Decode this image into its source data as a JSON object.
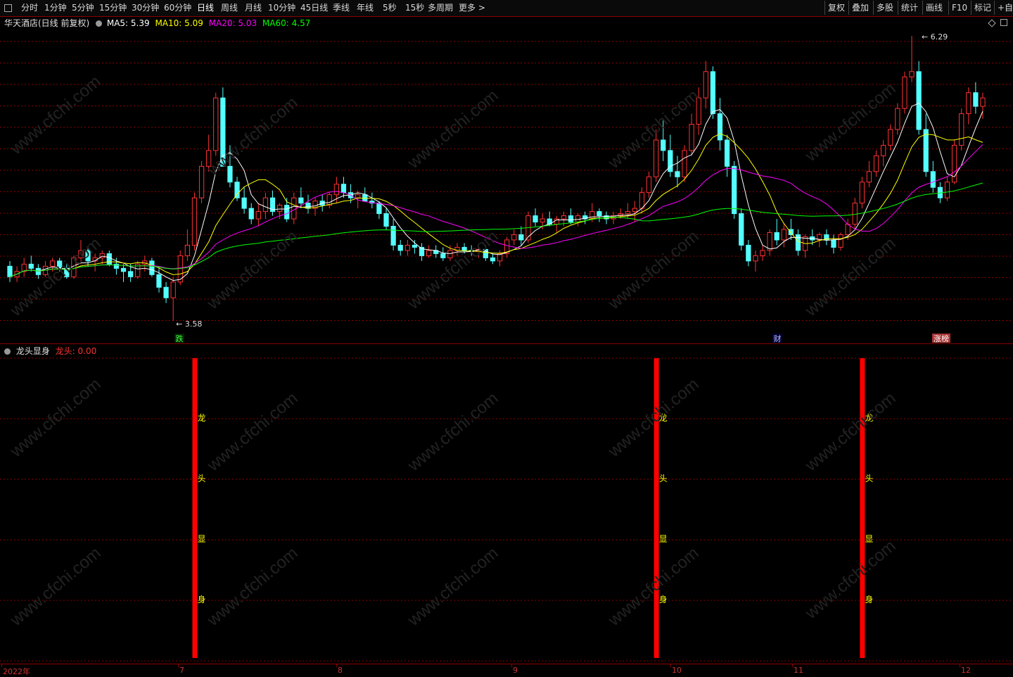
{
  "toolbar": {
    "periods": [
      "分时",
      "1分钟",
      "5分钟",
      "15分钟",
      "30分钟",
      "60分钟",
      "日线",
      "周线",
      "月线",
      "10分钟",
      "45日线",
      "季线",
      "年线",
      "5秒",
      "15秒",
      "多周期",
      "更多 >"
    ],
    "active": "日线",
    "right_buttons": [
      "复权",
      "叠加",
      "多股",
      "统计",
      "画线",
      "F10",
      "标记",
      "+自"
    ]
  },
  "main": {
    "title": "华天酒店(日线 前复权)",
    "ma5_label": "MA5: 5.39",
    "ma10_label": "MA10: 5.09",
    "ma20_label": "MA20: 5.03",
    "ma60_label": "MA60: 4.57",
    "max_label": "6.29",
    "min_label": "3.58",
    "event_markers": [
      "跌",
      "财",
      "涨榜"
    ]
  },
  "sub": {
    "title": "龙头显身",
    "value_label": "龙头: 0.00",
    "bar_chars": [
      "龙",
      "头",
      "显",
      "身"
    ]
  },
  "xaxis": {
    "labels": [
      "2022年",
      "7",
      "8",
      "9",
      "10",
      "11",
      "12"
    ]
  },
  "watermark": "www.cfchi.com",
  "colors": {
    "up": "#ff3232",
    "down": "#54ffff",
    "ma5": "#ffffff",
    "ma10": "#ffff00",
    "ma20": "#ff00ff",
    "ma60": "#00ff00",
    "grid": "#8b0000",
    "signal": "#ff0000"
  },
  "chart_data": {
    "type": "candlestick",
    "ylim": [
      3.5,
      6.35
    ],
    "max_price": 6.29,
    "min_price": 3.58,
    "candles": [
      [
        4.1,
        4.15,
        3.95,
        4.0
      ],
      [
        4.0,
        4.1,
        3.95,
        4.05
      ],
      [
        4.05,
        4.18,
        4.0,
        4.12
      ],
      [
        4.12,
        4.2,
        4.05,
        4.08
      ],
      [
        4.08,
        4.12,
        3.98,
        4.02
      ],
      [
        4.02,
        4.15,
        4.0,
        4.1
      ],
      [
        4.1,
        4.18,
        4.05,
        4.15
      ],
      [
        4.15,
        4.18,
        4.05,
        4.08
      ],
      [
        4.08,
        4.12,
        3.98,
        4.0
      ],
      [
        4.0,
        4.2,
        3.98,
        4.18
      ],
      [
        4.18,
        4.35,
        4.12,
        4.25
      ],
      [
        4.25,
        4.28,
        4.1,
        4.15
      ],
      [
        4.15,
        4.22,
        4.05,
        4.18
      ],
      [
        4.18,
        4.25,
        4.12,
        4.22
      ],
      [
        4.22,
        4.25,
        4.1,
        4.12
      ],
      [
        4.12,
        4.18,
        4.02,
        4.08
      ],
      [
        4.08,
        4.12,
        3.95,
        4.05
      ],
      [
        4.05,
        4.12,
        3.95,
        4.0
      ],
      [
        4.0,
        4.15,
        3.98,
        4.12
      ],
      [
        4.12,
        4.2,
        4.05,
        4.15
      ],
      [
        4.15,
        4.18,
        4.0,
        4.02
      ],
      [
        4.02,
        4.08,
        3.85,
        3.9
      ],
      [
        3.9,
        3.95,
        3.75,
        3.8
      ],
      [
        3.8,
        4.0,
        3.58,
        3.95
      ],
      [
        3.95,
        4.25,
        3.92,
        4.2
      ],
      [
        4.2,
        4.45,
        4.15,
        4.3
      ],
      [
        4.3,
        4.8,
        4.25,
        4.75
      ],
      [
        4.75,
        5.1,
        4.7,
        5.05
      ],
      [
        5.05,
        5.35,
        5.0,
        5.2
      ],
      [
        5.2,
        5.75,
        5.15,
        5.7
      ],
      [
        5.7,
        5.8,
        5.05,
        5.05
      ],
      [
        5.05,
        5.25,
        4.85,
        4.9
      ],
      [
        4.9,
        4.95,
        4.72,
        4.75
      ],
      [
        4.75,
        4.85,
        4.6,
        4.65
      ],
      [
        4.65,
        4.7,
        4.5,
        4.55
      ],
      [
        4.55,
        4.7,
        4.48,
        4.62
      ],
      [
        4.62,
        4.8,
        4.55,
        4.75
      ],
      [
        4.75,
        4.82,
        4.58,
        4.62
      ],
      [
        4.62,
        4.7,
        4.55,
        4.68
      ],
      [
        4.68,
        4.75,
        4.52,
        4.55
      ],
      [
        4.55,
        4.8,
        4.5,
        4.75
      ],
      [
        4.75,
        4.85,
        4.65,
        4.7
      ],
      [
        4.7,
        4.78,
        4.6,
        4.65
      ],
      [
        4.65,
        4.75,
        4.58,
        4.72
      ],
      [
        4.72,
        4.78,
        4.62,
        4.68
      ],
      [
        4.68,
        4.8,
        4.65,
        4.78
      ],
      [
        4.78,
        4.95,
        4.7,
        4.88
      ],
      [
        4.88,
        4.95,
        4.75,
        4.8
      ],
      [
        4.8,
        4.88,
        4.7,
        4.75
      ],
      [
        4.75,
        4.82,
        4.65,
        4.78
      ],
      [
        4.78,
        4.85,
        4.72,
        4.72
      ],
      [
        4.72,
        4.8,
        4.65,
        4.7
      ],
      [
        4.7,
        4.72,
        4.55,
        4.6
      ],
      [
        4.6,
        4.65,
        4.45,
        4.48
      ],
      [
        4.48,
        4.55,
        4.25,
        4.3
      ],
      [
        4.3,
        4.35,
        4.2,
        4.25
      ],
      [
        4.25,
        4.35,
        4.2,
        4.3
      ],
      [
        4.3,
        4.35,
        4.22,
        4.28
      ],
      [
        4.28,
        4.32,
        4.15,
        4.2
      ],
      [
        4.2,
        4.3,
        4.18,
        4.25
      ],
      [
        4.25,
        4.3,
        4.18,
        4.22
      ],
      [
        4.22,
        4.28,
        4.15,
        4.18
      ],
      [
        4.18,
        4.3,
        4.15,
        4.25
      ],
      [
        4.25,
        4.32,
        4.2,
        4.28
      ],
      [
        4.28,
        4.32,
        4.22,
        4.25
      ],
      [
        4.25,
        4.3,
        4.2,
        4.24
      ],
      [
        4.24,
        4.3,
        4.18,
        4.26
      ],
      [
        4.26,
        4.3,
        4.15,
        4.18
      ],
      [
        4.18,
        4.22,
        4.12,
        4.15
      ],
      [
        4.15,
        4.25,
        4.1,
        4.22
      ],
      [
        4.22,
        4.38,
        4.18,
        4.35
      ],
      [
        4.35,
        4.45,
        4.3,
        4.4
      ],
      [
        4.4,
        4.48,
        4.3,
        4.35
      ],
      [
        4.35,
        4.62,
        4.32,
        4.58
      ],
      [
        4.58,
        4.65,
        4.48,
        4.52
      ],
      [
        4.52,
        4.6,
        4.45,
        4.55
      ],
      [
        4.55,
        4.62,
        4.48,
        4.5
      ],
      [
        4.5,
        4.58,
        4.42,
        4.55
      ],
      [
        4.55,
        4.62,
        4.48,
        4.58
      ],
      [
        4.58,
        4.65,
        4.5,
        4.52
      ],
      [
        4.52,
        4.6,
        4.48,
        4.58
      ],
      [
        4.58,
        4.62,
        4.5,
        4.55
      ],
      [
        4.55,
        4.7,
        4.52,
        4.62
      ],
      [
        4.62,
        4.65,
        4.52,
        4.58
      ],
      [
        4.58,
        4.62,
        4.5,
        4.55
      ],
      [
        4.55,
        4.62,
        4.5,
        4.58
      ],
      [
        4.58,
        4.65,
        4.55,
        4.6
      ],
      [
        4.6,
        4.7,
        4.55,
        4.62
      ],
      [
        4.62,
        4.72,
        4.52,
        4.65
      ],
      [
        4.65,
        4.85,
        4.6,
        4.8
      ],
      [
        4.8,
        5.0,
        4.75,
        4.95
      ],
      [
        4.95,
        5.4,
        4.9,
        5.3
      ],
      [
        5.3,
        5.5,
        5.1,
        5.2
      ],
      [
        5.2,
        5.35,
        4.95,
        5.0
      ],
      [
        5.0,
        5.15,
        4.85,
        4.95
      ],
      [
        4.95,
        5.25,
        4.9,
        5.2
      ],
      [
        5.2,
        5.55,
        5.15,
        5.45
      ],
      [
        5.45,
        5.8,
        5.35,
        5.7
      ],
      [
        5.7,
        6.05,
        5.6,
        5.95
      ],
      [
        5.95,
        6.0,
        5.5,
        5.55
      ],
      [
        5.55,
        5.7,
        5.2,
        5.3
      ],
      [
        5.3,
        5.35,
        4.95,
        5.05
      ],
      [
        5.05,
        5.1,
        4.55,
        4.6
      ],
      [
        4.6,
        4.65,
        4.25,
        4.3
      ],
      [
        4.3,
        4.35,
        4.1,
        4.15
      ],
      [
        4.15,
        4.25,
        4.05,
        4.2
      ],
      [
        4.2,
        4.3,
        4.15,
        4.25
      ],
      [
        4.25,
        4.45,
        4.2,
        4.42
      ],
      [
        4.42,
        4.55,
        4.3,
        4.35
      ],
      [
        4.35,
        4.5,
        4.28,
        4.45
      ],
      [
        4.45,
        4.55,
        4.35,
        4.4
      ],
      [
        4.4,
        4.45,
        4.2,
        4.25
      ],
      [
        4.25,
        4.4,
        4.18,
        4.38
      ],
      [
        4.38,
        4.45,
        4.3,
        4.35
      ],
      [
        4.35,
        4.42,
        4.28,
        4.4
      ],
      [
        4.4,
        4.45,
        4.3,
        4.35
      ],
      [
        4.35,
        4.4,
        4.22,
        4.28
      ],
      [
        4.28,
        4.42,
        4.25,
        4.4
      ],
      [
        4.4,
        4.55,
        4.35,
        4.5
      ],
      [
        4.5,
        4.75,
        4.45,
        4.7
      ],
      [
        4.7,
        4.95,
        4.65,
        4.9
      ],
      [
        4.9,
        5.1,
        4.85,
        5.0
      ],
      [
        5.0,
        5.2,
        4.95,
        5.15
      ],
      [
        5.15,
        5.3,
        5.05,
        5.25
      ],
      [
        5.25,
        5.45,
        5.2,
        5.4
      ],
      [
        5.4,
        5.65,
        5.35,
        5.6
      ],
      [
        5.6,
        5.95,
        5.55,
        5.9
      ],
      [
        5.9,
        6.29,
        5.85,
        5.95
      ],
      [
        5.95,
        6.05,
        5.35,
        5.4
      ],
      [
        5.4,
        5.55,
        4.95,
        5.0
      ],
      [
        5.0,
        5.1,
        4.8,
        4.85
      ],
      [
        4.85,
        4.9,
        4.7,
        4.75
      ],
      [
        4.75,
        4.95,
        4.72,
        4.9
      ],
      [
        4.9,
        5.3,
        4.88,
        5.25
      ],
      [
        5.25,
        5.6,
        5.2,
        5.55
      ],
      [
        5.55,
        5.8,
        5.45,
        5.75
      ],
      [
        5.75,
        5.85,
        5.55,
        5.62
      ],
      [
        5.62,
        5.75,
        5.5,
        5.7
      ]
    ],
    "ma_note": "MA series (MA5, MA10, MA20, MA60) computed from candle closes",
    "signal_bars_at_candle_index": [
      26,
      91,
      120
    ]
  }
}
